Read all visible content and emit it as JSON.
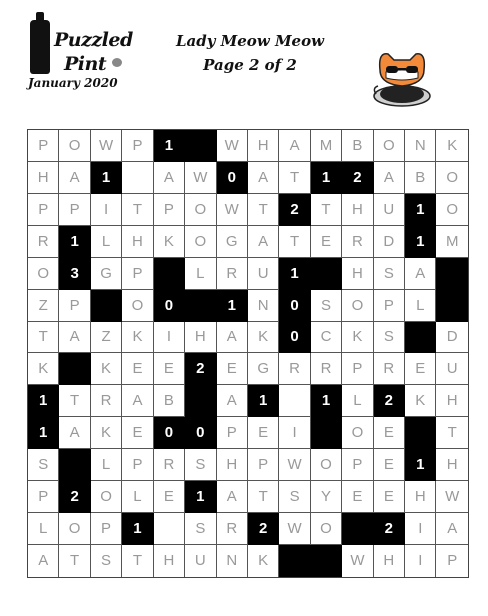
{
  "logo": {
    "word1": "Puzzled",
    "word2": "Pint",
    "date": "January 2020"
  },
  "header": {
    "title": "Lady Meow Meow",
    "subtitle": "Page 2 of 2"
  },
  "grid": {
    "rows": [
      [
        {
          "t": "P"
        },
        {
          "t": "O"
        },
        {
          "t": "W"
        },
        {
          "t": "P"
        },
        {
          "t": "1",
          "b": true
        },
        {
          "t": "",
          "b": true
        },
        {
          "t": "W"
        },
        {
          "t": "H"
        },
        {
          "t": "A"
        },
        {
          "t": "M"
        },
        {
          "t": "B"
        },
        {
          "t": "O"
        },
        {
          "t": "N"
        },
        {
          "t": "K"
        }
      ],
      [
        {
          "t": "H"
        },
        {
          "t": "A"
        },
        {
          "t": "1",
          "b": true
        },
        {
          "t": ""
        },
        {
          "t": "A"
        },
        {
          "t": "W"
        },
        {
          "t": "0",
          "b": true
        },
        {
          "t": "A"
        },
        {
          "t": "T"
        },
        {
          "t": "1",
          "b": true
        },
        {
          "t": "2",
          "b": true
        },
        {
          "t": "A"
        },
        {
          "t": "B"
        },
        {
          "t": "O"
        }
      ],
      [
        {
          "t": "P"
        },
        {
          "t": "P"
        },
        {
          "t": "I"
        },
        {
          "t": "T"
        },
        {
          "t": "P"
        },
        {
          "t": "O"
        },
        {
          "t": "W"
        },
        {
          "t": "T"
        },
        {
          "t": "2",
          "b": true
        },
        {
          "t": "T"
        },
        {
          "t": "H"
        },
        {
          "t": "U"
        },
        {
          "t": "1",
          "b": true
        },
        {
          "t": "O"
        }
      ],
      [
        {
          "t": "R"
        },
        {
          "t": "1",
          "b": true
        },
        {
          "t": "L"
        },
        {
          "t": "H"
        },
        {
          "t": "K"
        },
        {
          "t": "O"
        },
        {
          "t": "G"
        },
        {
          "t": "A"
        },
        {
          "t": "T"
        },
        {
          "t": "E"
        },
        {
          "t": "R"
        },
        {
          "t": "D"
        },
        {
          "t": "1",
          "b": true
        },
        {
          "t": "M"
        }
      ],
      [
        {
          "t": "O"
        },
        {
          "t": "3",
          "b": true
        },
        {
          "t": "G"
        },
        {
          "t": "P"
        },
        {
          "t": "",
          "b": true
        },
        {
          "t": "L"
        },
        {
          "t": "R"
        },
        {
          "t": "U"
        },
        {
          "t": "1",
          "b": true
        },
        {
          "t": "",
          "b": true
        },
        {
          "t": "H"
        },
        {
          "t": "S"
        },
        {
          "t": "A"
        },
        {
          "t": "",
          "b": true
        }
      ],
      [
        {
          "t": "Z"
        },
        {
          "t": "P"
        },
        {
          "t": "",
          "b": true
        },
        {
          "t": "O"
        },
        {
          "t": "0",
          "b": true
        },
        {
          "t": "",
          "b": true
        },
        {
          "t": "1",
          "b": true
        },
        {
          "t": "N"
        },
        {
          "t": "0",
          "b": true
        },
        {
          "t": "S"
        },
        {
          "t": "O"
        },
        {
          "t": "P"
        },
        {
          "t": "L"
        },
        {
          "t": "",
          "b": true
        }
      ],
      [
        {
          "t": "T"
        },
        {
          "t": "A"
        },
        {
          "t": "Z"
        },
        {
          "t": "K"
        },
        {
          "t": "I"
        },
        {
          "t": "H"
        },
        {
          "t": "A"
        },
        {
          "t": "K"
        },
        {
          "t": "0",
          "b": true
        },
        {
          "t": "C"
        },
        {
          "t": "K"
        },
        {
          "t": "S"
        },
        {
          "t": "",
          "b": true
        },
        {
          "t": "D"
        }
      ],
      [
        {
          "t": "K"
        },
        {
          "t": "",
          "b": true
        },
        {
          "t": "K"
        },
        {
          "t": "E"
        },
        {
          "t": "E"
        },
        {
          "t": "2",
          "b": true
        },
        {
          "t": "E"
        },
        {
          "t": "G"
        },
        {
          "t": "R"
        },
        {
          "t": "R"
        },
        {
          "t": "P"
        },
        {
          "t": "R"
        },
        {
          "t": "E"
        },
        {
          "t": "U"
        }
      ],
      [
        {
          "t": "1",
          "b": true
        },
        {
          "t": "T"
        },
        {
          "t": "R"
        },
        {
          "t": "A"
        },
        {
          "t": "B"
        },
        {
          "t": "",
          "b": true
        },
        {
          "t": "A"
        },
        {
          "t": "1",
          "b": true
        },
        {
          "t": ""
        },
        {
          "t": "1",
          "b": true
        },
        {
          "t": "L"
        },
        {
          "t": "2",
          "b": true
        },
        {
          "t": "K"
        },
        {
          "t": "H"
        }
      ],
      [
        {
          "t": "1",
          "b": true
        },
        {
          "t": "A"
        },
        {
          "t": "K"
        },
        {
          "t": "E"
        },
        {
          "t": "0",
          "b": true
        },
        {
          "t": "0",
          "b": true
        },
        {
          "t": "P"
        },
        {
          "t": "E"
        },
        {
          "t": "I"
        },
        {
          "t": "",
          "b": true
        },
        {
          "t": "O"
        },
        {
          "t": "E"
        },
        {
          "t": "",
          "b": true
        },
        {
          "t": "T"
        }
      ],
      [
        {
          "t": "S"
        },
        {
          "t": "",
          "b": true
        },
        {
          "t": "L"
        },
        {
          "t": "P"
        },
        {
          "t": "R"
        },
        {
          "t": "S"
        },
        {
          "t": "H"
        },
        {
          "t": "P"
        },
        {
          "t": "W"
        },
        {
          "t": "O"
        },
        {
          "t": "P"
        },
        {
          "t": "E"
        },
        {
          "t": "1",
          "b": true
        },
        {
          "t": "H"
        }
      ],
      [
        {
          "t": "P"
        },
        {
          "t": "2",
          "b": true
        },
        {
          "t": "O"
        },
        {
          "t": "L"
        },
        {
          "t": "E"
        },
        {
          "t": "1",
          "b": true
        },
        {
          "t": "A"
        },
        {
          "t": "T"
        },
        {
          "t": "S"
        },
        {
          "t": "Y"
        },
        {
          "t": "E"
        },
        {
          "t": "E"
        },
        {
          "t": "H"
        },
        {
          "t": "W"
        }
      ],
      [
        {
          "t": "L"
        },
        {
          "t": "O"
        },
        {
          "t": "P"
        },
        {
          "t": "1",
          "b": true
        },
        {
          "t": ""
        },
        {
          "t": "S"
        },
        {
          "t": "R"
        },
        {
          "t": "2",
          "b": true
        },
        {
          "t": "W"
        },
        {
          "t": "O"
        },
        {
          "t": "",
          "b": true
        },
        {
          "t": "2",
          "b": true
        },
        {
          "t": "I"
        },
        {
          "t": "A"
        }
      ],
      [
        {
          "t": "A"
        },
        {
          "t": "T"
        },
        {
          "t": "S"
        },
        {
          "t": "T"
        },
        {
          "t": "H"
        },
        {
          "t": "U"
        },
        {
          "t": "N"
        },
        {
          "t": "K"
        },
        {
          "t": "",
          "b": true
        },
        {
          "t": "",
          "b": true
        },
        {
          "t": "W"
        },
        {
          "t": "H"
        },
        {
          "t": "I"
        },
        {
          "t": "P"
        }
      ]
    ]
  }
}
